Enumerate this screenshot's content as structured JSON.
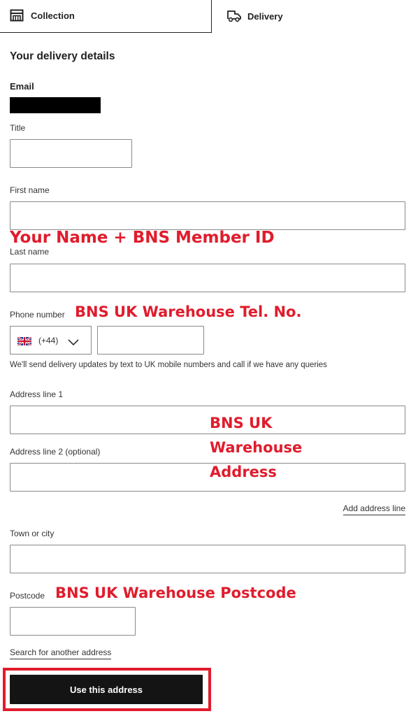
{
  "tabs": [
    {
      "label": "Collection",
      "icon": "store-icon",
      "selected": false
    },
    {
      "label": "Delivery",
      "icon": "van-icon",
      "selected": true
    }
  ],
  "form": {
    "heading": "Your delivery details",
    "email_label": "Email",
    "email_value": "[redacted]",
    "title_label": "Title",
    "title_value": "",
    "first_name_label": "First name",
    "first_name_value": "",
    "last_name_label": "Last name",
    "last_name_value": "",
    "phone_label": "Phone number",
    "phone_country_code": "(+44)",
    "phone_country_flag": "uk-flag",
    "phone_value": "",
    "phone_helper": "We'll send delivery updates by text to UK mobile numbers and call if we have any queries",
    "address1_label": "Address line 1",
    "address1_value": "",
    "address2_label": "Address line 2 (optional)",
    "address2_value": "",
    "add_address_line": "Add address line",
    "town_label": "Town or city",
    "town_value": "",
    "postcode_label": "Postcode",
    "postcode_value": "",
    "search_another": "Search for another address",
    "submit_label": "Use this address"
  },
  "annotations": {
    "name_note": "Your Name + BNS Member ID",
    "phone_note": "BNS UK Warehouse Tel. No.",
    "address_note_1": "BNS UK",
    "address_note_2": "Warehouse",
    "address_note_3": "Address",
    "postcode_note": "BNS UK Warehouse Postcode",
    "color": "#e01c2c"
  }
}
